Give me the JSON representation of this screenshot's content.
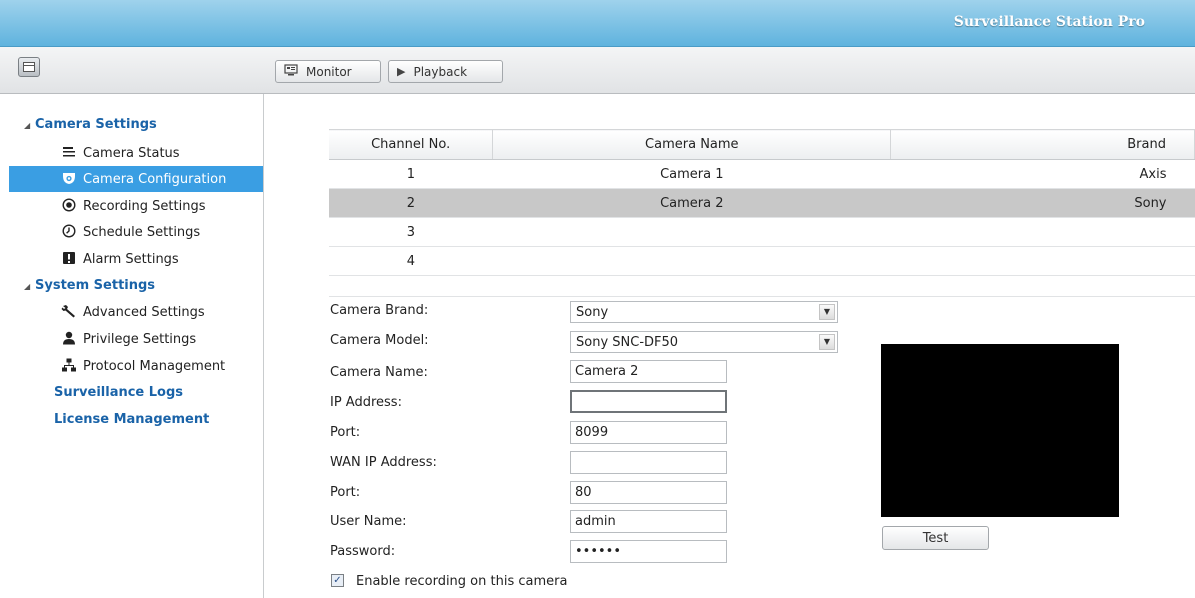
{
  "app": {
    "title": "Surveillance Station Pro"
  },
  "toolbar": {
    "layout_icon": "window-layout-icon",
    "monitor_label": "Monitor",
    "monitor_icon": "monitor-icon",
    "playback_label": "Playback",
    "playback_icon": "play-icon"
  },
  "sidebar": {
    "camera_settings": {
      "label": "Camera Settings",
      "items": [
        {
          "label": "Camera Status",
          "icon": "list-icon"
        },
        {
          "label": "Camera Configuration",
          "icon": "camera-icon",
          "active": true
        },
        {
          "label": "Recording Settings",
          "icon": "record-icon"
        },
        {
          "label": "Schedule Settings",
          "icon": "clock-icon"
        },
        {
          "label": "Alarm Settings",
          "icon": "alarm-icon"
        }
      ]
    },
    "system_settings": {
      "label": "System Settings",
      "items": [
        {
          "label": "Advanced Settings",
          "icon": "wrench-icon"
        },
        {
          "label": "Privilege Settings",
          "icon": "user-icon"
        },
        {
          "label": "Protocol Management",
          "icon": "network-icon"
        }
      ]
    },
    "surveillance_logs": "Surveillance Logs",
    "license_management": "License Management"
  },
  "camera_table": {
    "headers": [
      "Channel No.",
      "Camera Name",
      "Brand"
    ],
    "rows": [
      {
        "channel": "1",
        "name": "Camera 1",
        "brand": "Axis"
      },
      {
        "channel": "2",
        "name": "Camera 2",
        "brand": "Sony",
        "selected": true
      },
      {
        "channel": "3",
        "name": "",
        "brand": ""
      },
      {
        "channel": "4",
        "name": "",
        "brand": ""
      }
    ]
  },
  "form": {
    "camera_brand": {
      "label": "Camera Brand:",
      "value": "Sony"
    },
    "camera_model": {
      "label": "Camera Model:",
      "value": "Sony SNC-DF50"
    },
    "camera_name": {
      "label": "Camera Name:",
      "value": "Camera 2"
    },
    "ip_address": {
      "label": "IP Address:",
      "value": ""
    },
    "port": {
      "label": "Port:",
      "value": "8099"
    },
    "wan_ip": {
      "label": "WAN IP Address:",
      "value": ""
    },
    "wan_port": {
      "label": "Port:",
      "value": "80"
    },
    "user_name": {
      "label": "User Name:",
      "value": "admin"
    },
    "password": {
      "label": "Password:",
      "value": "••••••"
    },
    "enable_recording": {
      "label": "Enable recording on this camera",
      "checked": true
    }
  },
  "preview": {
    "test_label": "Test"
  }
}
